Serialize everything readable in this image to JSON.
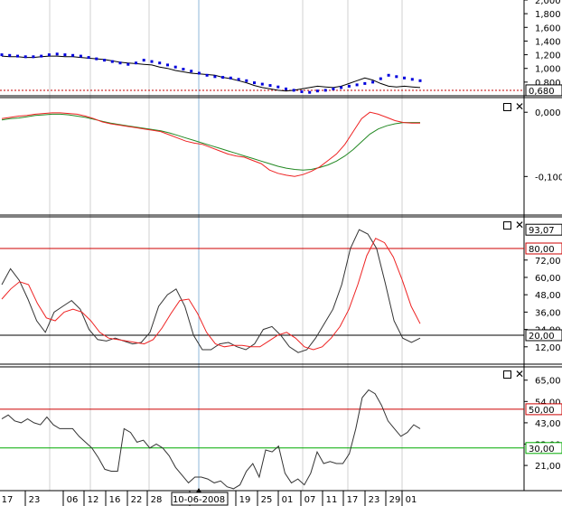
{
  "chart_data": [
    {
      "type": "line",
      "yticks": [
        "2,000",
        "1,800",
        "1,600",
        "1,400",
        "1,200",
        "1,000",
        "0,800"
      ],
      "current_value_label": "0,680",
      "ref_level": 0.68,
      "colors": {
        "price": "#000000",
        "sar": "#0000dd",
        "ref": "#c00000"
      },
      "price": [
        1.18,
        1.17,
        1.17,
        1.16,
        1.16,
        1.17,
        1.18,
        1.18,
        1.17,
        1.17,
        1.16,
        1.15,
        1.14,
        1.13,
        1.11,
        1.09,
        1.08,
        1.07,
        1.06,
        1.05,
        1.02,
        1.0,
        0.97,
        0.95,
        0.93,
        0.92,
        0.91,
        0.9,
        0.87,
        0.85,
        0.82,
        0.79,
        0.75,
        0.72,
        0.7,
        0.68,
        0.67,
        0.68,
        0.7,
        0.72,
        0.74,
        0.73,
        0.72,
        0.74,
        0.78,
        0.82,
        0.86,
        0.83,
        0.78,
        0.74,
        0.73,
        0.74,
        0.73,
        0.72
      ],
      "sar": [
        1.2,
        1.19,
        1.18,
        1.17,
        1.17,
        1.18,
        1.2,
        1.21,
        1.2,
        1.19,
        1.18,
        1.16,
        1.14,
        1.12,
        1.1,
        1.08,
        1.06,
        1.08,
        1.12,
        1.1,
        1.08,
        1.05,
        1.02,
        0.99,
        0.96,
        0.93,
        0.9,
        0.88,
        0.87,
        0.86,
        0.84,
        0.82,
        0.79,
        0.77,
        0.75,
        0.73,
        0.7,
        0.68,
        0.66,
        0.65,
        0.67,
        0.68,
        0.7,
        0.72,
        0.74,
        0.76,
        0.78,
        0.8,
        0.85,
        0.9,
        0.88,
        0.86,
        0.84,
        0.82
      ]
    },
    {
      "type": "line",
      "yticks": [
        "0,000",
        "-0,100"
      ],
      "colors": {
        "fast": "#ee2222",
        "slow": "#228822"
      },
      "fast": [
        -0.01,
        -0.008,
        -0.006,
        -0.005,
        -0.003,
        -0.002,
        -0.001,
        -0.001,
        -0.002,
        -0.003,
        -0.006,
        -0.01,
        -0.015,
        -0.018,
        -0.02,
        -0.022,
        -0.024,
        -0.026,
        -0.028,
        -0.03,
        -0.035,
        -0.04,
        -0.045,
        -0.048,
        -0.05,
        -0.055,
        -0.06,
        -0.065,
        -0.068,
        -0.07,
        -0.075,
        -0.08,
        -0.09,
        -0.095,
        -0.098,
        -0.1,
        -0.097,
        -0.092,
        -0.085,
        -0.075,
        -0.065,
        -0.05,
        -0.03,
        -0.01,
        0.0,
        -0.003,
        -0.008,
        -0.013,
        -0.016,
        -0.017,
        -0.017
      ],
      "slow": [
        -0.012,
        -0.01,
        -0.009,
        -0.007,
        -0.005,
        -0.004,
        -0.003,
        -0.003,
        -0.004,
        -0.006,
        -0.008,
        -0.011,
        -0.014,
        -0.017,
        -0.019,
        -0.021,
        -0.023,
        -0.025,
        -0.027,
        -0.029,
        -0.032,
        -0.036,
        -0.04,
        -0.044,
        -0.048,
        -0.052,
        -0.056,
        -0.06,
        -0.064,
        -0.068,
        -0.072,
        -0.076,
        -0.08,
        -0.084,
        -0.087,
        -0.089,
        -0.09,
        -0.089,
        -0.086,
        -0.082,
        -0.076,
        -0.068,
        -0.058,
        -0.046,
        -0.034,
        -0.026,
        -0.021,
        -0.018,
        -0.016,
        -0.016,
        -0.016
      ]
    },
    {
      "type": "line",
      "yticks": [
        "72,00",
        "60,00",
        "48,00",
        "36,00",
        "24,00",
        "12,00"
      ],
      "current_value_label": "93,07",
      "levels": [
        {
          "value": 80,
          "label": "80,00",
          "color": "#cc0000"
        },
        {
          "value": 20,
          "label": "20,00",
          "color": "#000000"
        }
      ],
      "colors": {
        "k": "#333333",
        "d": "#ee2222"
      },
      "k": [
        55,
        66,
        58,
        45,
        30,
        22,
        36,
        40,
        44,
        38,
        24,
        17,
        16,
        18,
        16,
        14,
        15,
        22,
        40,
        48,
        52,
        40,
        20,
        10,
        10,
        14,
        15,
        12,
        10,
        14,
        24,
        26,
        20,
        12,
        8,
        10,
        18,
        28,
        38,
        55,
        80,
        93,
        90,
        80,
        56,
        30,
        18,
        15,
        18
      ],
      "d": [
        45,
        52,
        57,
        55,
        42,
        32,
        30,
        36,
        38,
        36,
        30,
        22,
        18,
        17,
        16,
        15,
        14,
        17,
        25,
        35,
        44,
        45,
        35,
        22,
        14,
        12,
        13,
        13,
        12,
        12,
        16,
        20,
        22,
        18,
        12,
        10,
        12,
        18,
        26,
        38,
        55,
        75,
        87,
        84,
        74,
        58,
        40,
        28
      ],
      "k_marker": 85
    },
    {
      "type": "line",
      "yticks": [
        "65,00",
        "54,00",
        "43,00",
        "32,00",
        "21,00"
      ],
      "levels": [
        {
          "value": 50,
          "label": "50,00",
          "color": "#cc0000"
        },
        {
          "value": 30,
          "label": "30,00",
          "color": "#00aa00"
        }
      ],
      "colors": {
        "line": "#333333"
      },
      "values": [
        45,
        47,
        44,
        43,
        45,
        43,
        42,
        46,
        42,
        40,
        40,
        40,
        36,
        33,
        30,
        25,
        19,
        18,
        18,
        40,
        38,
        33,
        34,
        30,
        32,
        30,
        26,
        20,
        16,
        12,
        15,
        15,
        14,
        12,
        13,
        10,
        9,
        11,
        18,
        22,
        15,
        29,
        28,
        31,
        17,
        12,
        14,
        11,
        17,
        28,
        22,
        23,
        22,
        22,
        27,
        40,
        56,
        60,
        58,
        52,
        44,
        40,
        36,
        38,
        42,
        40
      ]
    }
  ],
  "x_axis": {
    "labels": [
      "17",
      "23",
      "06",
      "12",
      "16",
      "22",
      "28",
      "10-06-2008",
      "19",
      "25",
      "01",
      "07",
      "11",
      "17",
      "23",
      "29",
      "01"
    ],
    "selected_label": "10-06-2008"
  }
}
